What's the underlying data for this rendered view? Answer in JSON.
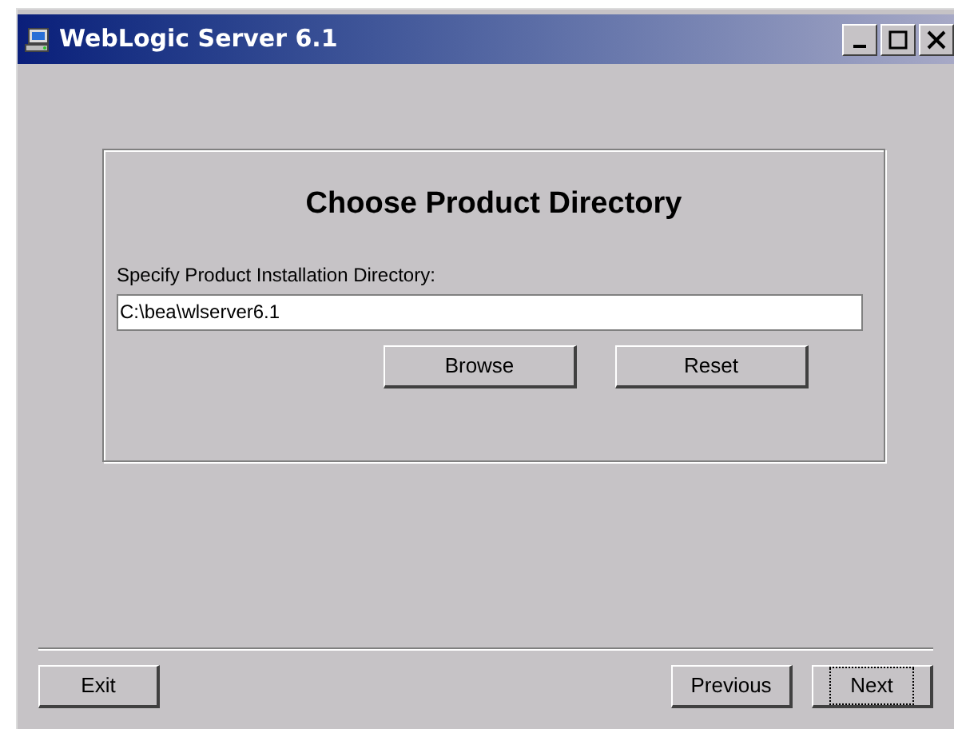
{
  "window": {
    "title": "WebLogic Server 6.1"
  },
  "panel": {
    "heading": "Choose Product Directory",
    "field_label": "Specify Product Installation Directory:",
    "field_value": "C:\\bea\\wlserver6.1",
    "buttons": [
      {
        "label": "Browse"
      },
      {
        "label": "Reset"
      }
    ]
  },
  "footer": {
    "left_buttons": [
      {
        "label": "Exit",
        "focused": false
      }
    ],
    "right_buttons": [
      {
        "label": "Previous",
        "focused": false
      },
      {
        "label": "Next",
        "focused": true
      }
    ]
  }
}
